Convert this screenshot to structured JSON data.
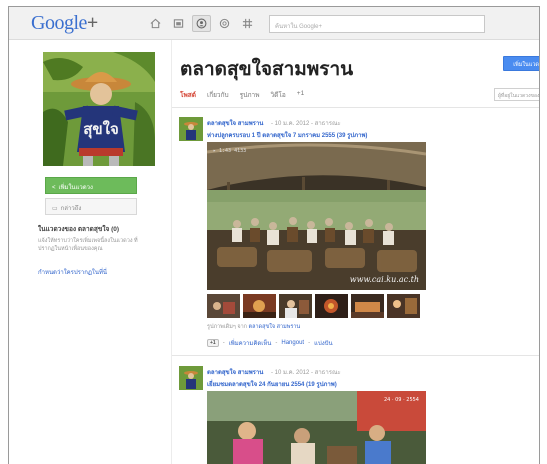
{
  "app": {
    "logo_main": "Google",
    "logo_plus": "+",
    "search_placeholder": "ค้นหาใน Google+"
  },
  "nav_icons": [
    {
      "name": "home-icon",
      "active": false
    },
    {
      "name": "photos-icon",
      "active": false
    },
    {
      "name": "profile-icon",
      "active": true
    },
    {
      "name": "circles-icon",
      "active": false
    },
    {
      "name": "games-icon",
      "active": false
    }
  ],
  "sidebar": {
    "add_button": "เพิ่มในแวดวง",
    "mention_button": "กล่าวถึง",
    "circles_title": "ในแวดวงของ ตลาดสุขใจ (0)",
    "circles_desc": "แจ้งให้ทราบว่าใครเพิ่มเพจนี้ลงในแวดวง ที่ปรากฏในหน้าเพื่อนของคุณ",
    "circles_link": "กำหนดว่าใครปรากฏในที่นี่"
  },
  "header": {
    "title": "ตลาดสุขใจสามพราน",
    "follow_button": "เพิ่มในแวดวง",
    "tabs": [
      "โพสต์",
      "เกี่ยวกับ",
      "รูปภาพ",
      "วิดีโอ",
      "+1"
    ],
    "active_tab": 0,
    "filter_placeholder": "ผู้ที่อยู่ในแวดวงของคุณ"
  },
  "posts": [
    {
      "author": "ตลาดสุขใจ สามพราน",
      "meta": "- 10 ม.ค. 2012 - สาธารณะ",
      "title": "ห่างปลูกครบรอบ 1 ปี ตลาดสุขใจ 7 มกราคม 2555 (39 รูปภาพ)",
      "watermark": "www.cai.ku.ac.th",
      "album_prefix": "รูปภาพเดิมๆ จาก",
      "album_link": "ตลาดสุขใจ สามพราน",
      "actions": [
        "+1",
        "เพิ่มความคิดเห็น",
        "Hangout",
        "แบ่งปัน"
      ]
    },
    {
      "author": "ตลาดสุขใจ สามพราน",
      "meta": "- 10 ม.ค. 2012 - สาธารณะ",
      "title": "เยี่ยมชมตลาดสุขใจ 24 กันยายน 2554 (19 รูปภาพ)"
    }
  ],
  "colors": {
    "accent_red": "#d54737",
    "link_blue": "#3366cc",
    "green_button": "#6dbb5b",
    "blue_button": "#4a8cf0"
  }
}
